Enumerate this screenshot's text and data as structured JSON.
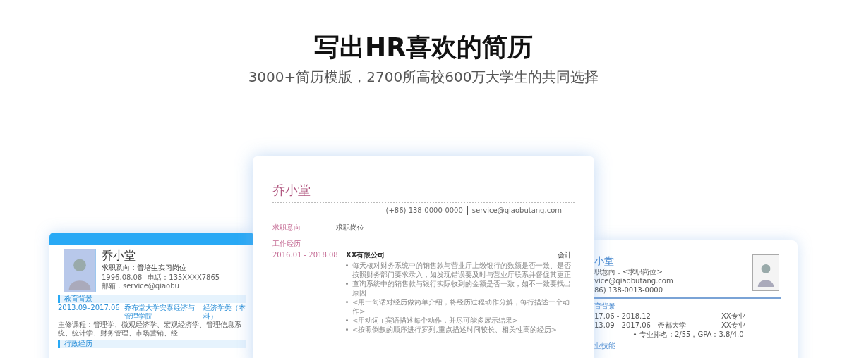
{
  "header": {
    "title": "写出HR喜欢的简历",
    "subtitle": "3000+简历模版，2700所高校600万大学生的共同选择"
  },
  "left_template": {
    "name": "乔小堂",
    "intent": "求职意向：管培生实习岗位",
    "birthday": "1996.08.08",
    "phone": "电话：135XXXX7865",
    "email": "邮箱：service@qiaobu",
    "sections": [
      {
        "title": "教育背景",
        "rows": [
          {
            "date": "2013.09–2017.06",
            "school": "乔布堂大学安泰经济与管理学院",
            "degree": "经济学类（本科）"
          }
        ],
        "note": "主修课程：管理学、微观经济学、宏观经济学、管理信息系统、统计学、财务管理、市场营销、经"
      },
      {
        "title": "行政经历"
      }
    ]
  },
  "center_template": {
    "name": "乔小堂",
    "phone": "(+86) 138-0000-0000",
    "email": "service@qiaobutang.com",
    "rows": [
      {
        "label": "求职意向",
        "value": "求职岗位"
      }
    ],
    "work_title": "工作经历",
    "work_date": "2016.01 - 2018.08",
    "company": "XX有限公司",
    "role": "会计",
    "bullets": [
      "每天核对财务系统中的销售款与营业厅上缴银行的数额是否一致、是否按照财务部门要求录入，如发现错误要及时与营业厅联系并督促其更正",
      "查询系统中的销售款与银行实际收到的金额是否一致，如不一致要找出原因",
      "<用一句话对经历做简单介绍，将经历过程动作分解，每行描述一个动作>",
      "<用动词+宾语描述每个动作，并尽可能多展示结果>",
      "<按照倒叙的顺序进行罗列,重点描述时间较长、相关性高的经历>"
    ]
  },
  "right_template": {
    "name": "小堂",
    "intent": "职意向：<求职岗位>",
    "email": "vice@qiaobutang.com",
    "phone": "86) 138-0013-0000",
    "section": "育背景",
    "rows": [
      {
        "date": "17.06 - 2018.12",
        "major": "XX专业"
      },
      {
        "date": "13.09 - 2017.06",
        "school": "帝都大学",
        "major": "XX专业"
      }
    ],
    "bullets": [
      "专业排名：2/55，GPA：3.8/4.0"
    ],
    "next_section": "业技能"
  }
}
